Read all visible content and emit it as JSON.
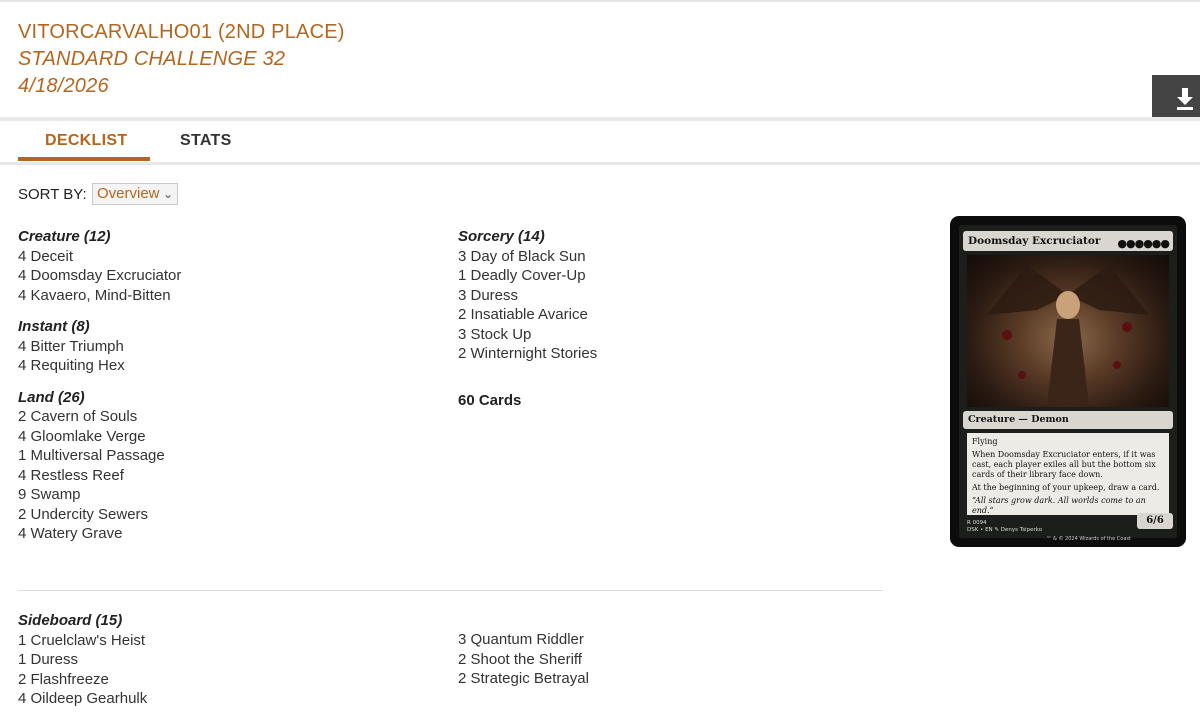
{
  "header": {
    "player": "VITORCARVALHO01 (2ND PLACE)",
    "event": "STANDARD CHALLENGE 32",
    "date": "4/18/2026"
  },
  "tabs": [
    {
      "label": "DECKLIST",
      "active": true
    },
    {
      "label": "STATS",
      "active": false
    }
  ],
  "sort": {
    "label": "SORT BY:",
    "value": "Overview"
  },
  "groups": {
    "creature": {
      "title": "Creature (12)",
      "cards": [
        "4 Deceit",
        "4 Doomsday Excruciator",
        "4 Kavaero, Mind-Bitten"
      ]
    },
    "instant": {
      "title": "Instant (8)",
      "cards": [
        "4 Bitter Triumph",
        "4 Requiting Hex"
      ]
    },
    "land": {
      "title": "Land (26)",
      "cards": [
        "2 Cavern of Souls",
        "4 Gloomlake Verge",
        "1 Multiversal Passage",
        "4 Restless Reef",
        "9 Swamp",
        "2 Undercity Sewers",
        "4 Watery Grave"
      ]
    },
    "sorcery": {
      "title": "Sorcery (14)",
      "cards": [
        "3 Day of Black Sun",
        "1 Deadly Cover-Up",
        "3 Duress",
        "2 Insatiable Avarice",
        "3 Stock Up",
        "2 Winternight Stories"
      ]
    }
  },
  "total": "60 Cards",
  "sideboard": {
    "title": "Sideboard (15)",
    "left": [
      "1 Cruelclaw's Heist",
      "1 Duress",
      "2 Flashfreeze",
      "4 Oildeep Gearhulk"
    ],
    "right": [
      "3 Quantum Riddler",
      "2 Shoot the Sheriff",
      "2 Strategic Betrayal"
    ]
  },
  "card_preview": {
    "name": "Doomsday Excruciator",
    "mana": "●●●●●●",
    "type_line": "Creature — Demon",
    "rules": [
      "Flying",
      "When Doomsday Excruciator enters, if it was cast, each player exiles all but the bottom six cards of their library face down.",
      "At the beginning of your upkeep, draw a card."
    ],
    "flavor": "“All stars grow dark. All worlds come to an end.”",
    "pt": "6/6",
    "footer": "R 0094\nDSK • EN ✎ Denys Tsiperko",
    "copyright": "™ & © 2024 Wizards of the Coast"
  },
  "colors": {
    "accent": "#b5651d",
    "text": "#333333"
  },
  "icons": {
    "download": "download-icon",
    "dropdown": "chevron-down-icon"
  }
}
